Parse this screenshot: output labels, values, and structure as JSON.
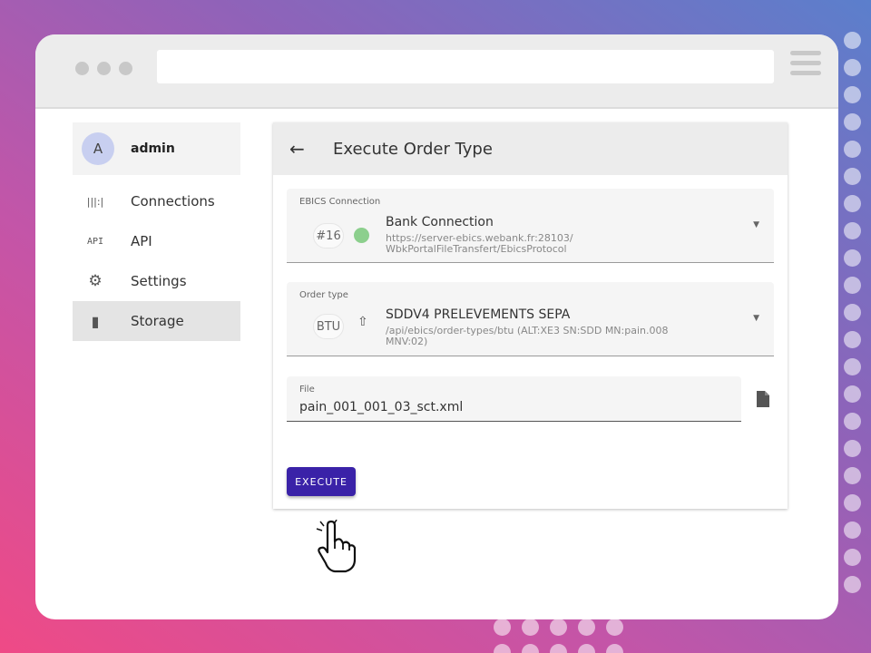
{
  "user": {
    "avatar_letter": "A",
    "name": "admin"
  },
  "sidebar": {
    "items": [
      {
        "icon": "connections-icon",
        "icon_glyph": "|||:|",
        "label": "Connections",
        "active": false
      },
      {
        "icon": "api-icon",
        "icon_glyph": "API",
        "label": "API",
        "active": false
      },
      {
        "icon": "gear-icon",
        "icon_glyph": "⚙",
        "label": "Settings",
        "active": false
      },
      {
        "icon": "sd-card-icon",
        "icon_glyph": "▮",
        "label": "Storage",
        "active": true
      }
    ]
  },
  "page": {
    "title": "Execute Order Type"
  },
  "ebics_connection": {
    "label": "EBICS Connection",
    "badge": "#16",
    "status_color": "#8ccf8d",
    "name": "Bank Connection",
    "url_line1": "https://server-ebics.webank.fr:28103/",
    "url_line2": "WbkPortalFileTransfert/EbicsProtocol"
  },
  "order_type": {
    "label": "Order type",
    "badge": "BTU",
    "name": "SDDV4 PRELEVEMENTS SEPA",
    "path_line1": "/api/ebics/order-types/btu (ALT:XE3 SN:SDD MN:pain.008",
    "path_line2": "MNV:02)"
  },
  "file": {
    "label": "File",
    "value": "pain_001_001_03_sct.xml"
  },
  "actions": {
    "execute_label": "EXECUTE"
  },
  "colors": {
    "accent": "#3a22a8"
  }
}
